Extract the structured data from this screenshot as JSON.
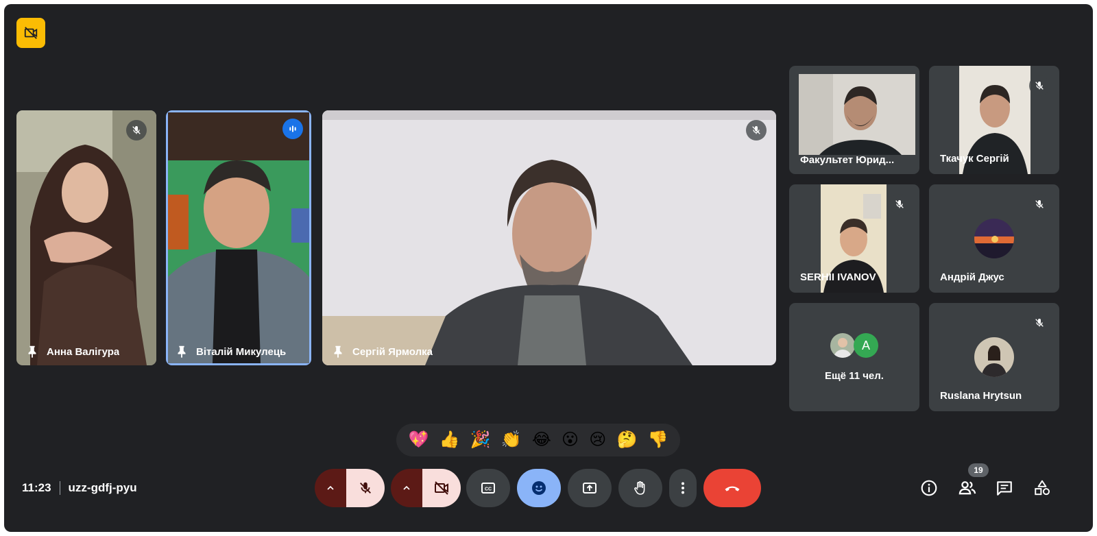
{
  "meeting": {
    "time": "11:23",
    "code": "uzz-gdfj-pyu",
    "participant_count": "19"
  },
  "main_tiles": [
    {
      "name": "Анна Валігура",
      "muted": true
    },
    {
      "name": "Віталій Микулець",
      "speaking": true
    },
    {
      "name": "Сергій Ярмолка",
      "muted": true
    }
  ],
  "side_tiles": [
    {
      "name": "Факультет Юрид...",
      "muted": false
    },
    {
      "name": "Ткачук Сергій",
      "muted": true
    },
    {
      "name": "SERHII IVANOV",
      "muted": true
    },
    {
      "name": "Андрій Джус",
      "muted": true
    },
    {
      "name": "Ещё 11 чел.",
      "avatar_letter": "A"
    },
    {
      "name": "Ruslana Hrytsun",
      "muted": true
    }
  ],
  "reactions": [
    "💖",
    "👍",
    "🎉",
    "👏",
    "😂",
    "😮",
    "😢",
    "🤔",
    "👎"
  ],
  "colors": {
    "background": "#202124",
    "tile": "#3c4043",
    "accent_blue": "#8ab4f8",
    "end_call": "#ea4335",
    "muted_control": "#f9dedc",
    "record_badge": "#fbbc04",
    "avatar_green": "#34a853"
  },
  "controls": {
    "mic": "mic-off-icon",
    "camera": "videocam-off-icon",
    "captions": "closed-caption-icon",
    "reactions": "emoji-icon",
    "present": "present-screen-icon",
    "hand": "raise-hand-icon",
    "more": "more-vert-icon",
    "end": "end-call-icon"
  }
}
